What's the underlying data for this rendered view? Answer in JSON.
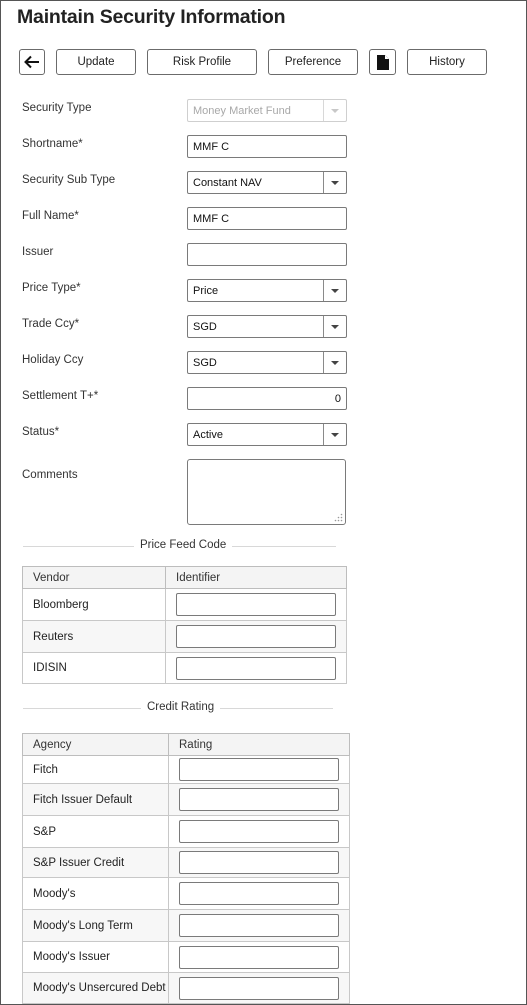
{
  "page": {
    "title": "Maintain Security Information"
  },
  "toolbar": {
    "back_icon": "arrow-left-icon",
    "update_label": "Update",
    "risk_profile_label": "Risk Profile",
    "preference_label": "Preference",
    "document_icon": "document-icon",
    "history_label": "History"
  },
  "form": {
    "security_type": {
      "label": "Security Type",
      "value": "Money Market Fund"
    },
    "shortname": {
      "label": "Shortname*",
      "value": "MMF C"
    },
    "security_sub_type": {
      "label": "Security Sub Type",
      "value": "Constant NAV"
    },
    "full_name": {
      "label": "Full Name*",
      "value": "MMF C"
    },
    "issuer": {
      "label": "Issuer",
      "value": ""
    },
    "price_type": {
      "label": "Price Type*",
      "value": "Price"
    },
    "trade_ccy": {
      "label": "Trade Ccy*",
      "value": "SGD"
    },
    "holiday_ccy": {
      "label": "Holiday Ccy",
      "value": "SGD"
    },
    "settlement": {
      "label": "Settlement T+*",
      "value": "0"
    },
    "status": {
      "label": "Status*",
      "value": "Active"
    },
    "comments": {
      "label": "Comments",
      "value": ""
    }
  },
  "price_feed": {
    "title": "Price Feed Code",
    "columns": [
      "Vendor",
      "Identifier"
    ],
    "rows": [
      {
        "vendor": "Bloomberg",
        "identifier": ""
      },
      {
        "vendor": "Reuters",
        "identifier": ""
      },
      {
        "vendor": "IDISIN",
        "identifier": ""
      }
    ]
  },
  "credit_rating": {
    "title": "Credit Rating",
    "columns": [
      "Agency",
      "Rating"
    ],
    "rows": [
      {
        "agency": "Fitch",
        "rating": ""
      },
      {
        "agency": "Fitch Issuer Default",
        "rating": ""
      },
      {
        "agency": "S&P",
        "rating": ""
      },
      {
        "agency": "S&P Issuer Credit",
        "rating": ""
      },
      {
        "agency": "Moody's",
        "rating": ""
      },
      {
        "agency": "Moody's Long Term",
        "rating": ""
      },
      {
        "agency": "Moody's Issuer",
        "rating": ""
      },
      {
        "agency": "Moody's Unsercured Debt",
        "rating": ""
      }
    ]
  }
}
